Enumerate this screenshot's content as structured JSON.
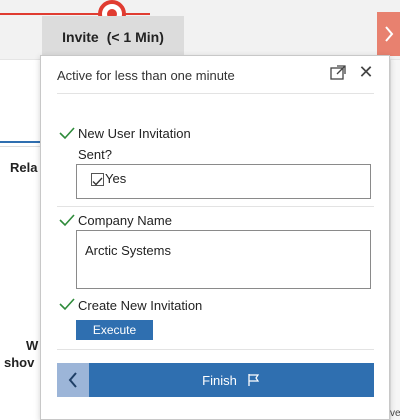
{
  "stage_bar": {
    "stage_name": "Invite",
    "stage_duration": "(< 1 Min)"
  },
  "background": {
    "rela": "Rela",
    "w": "W",
    "shov": "shov",
    "right_text": "ve"
  },
  "flyout": {
    "title": "Active for less than one minute",
    "steps": [
      {
        "label": "New User Invitation",
        "sublabel": "Sent?",
        "value": "Yes"
      },
      {
        "label": "Company Name",
        "value": "Arctic Systems"
      },
      {
        "label": "Create New Invitation",
        "button": "Execute"
      }
    ],
    "finish_label": "Finish"
  },
  "colors": {
    "accent_blue": "#2f6fb0",
    "active_red": "#e03c31",
    "check_green": "#2e8b3a"
  },
  "icons": {
    "popout": "popout-icon",
    "close": "close-icon",
    "check": "check-icon",
    "back": "chevron-left-icon",
    "next": "chevron-right-icon",
    "flag": "flag-icon"
  }
}
